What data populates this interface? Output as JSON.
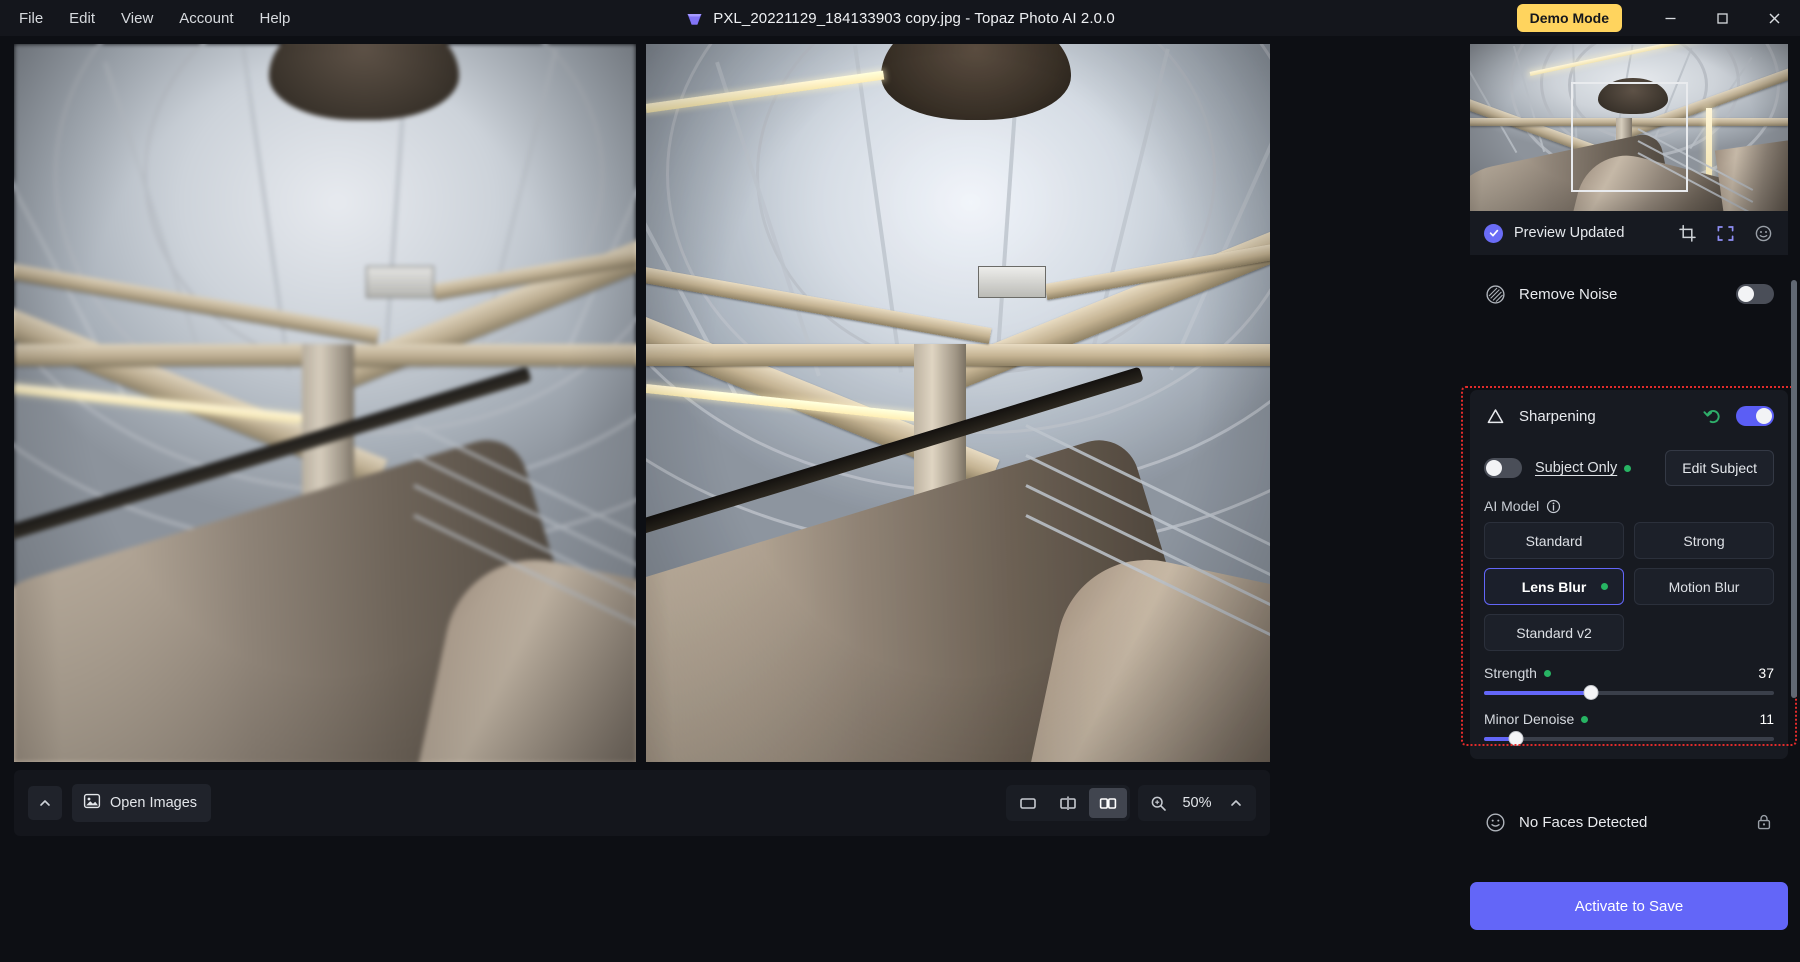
{
  "app": {
    "title": "PXL_20221129_184133903 copy.jpg - Topaz Photo AI 2.0.0",
    "logo_icon": "topaz-gem-icon",
    "accent_color": "#6366f8",
    "demo_badge": "Demo Mode",
    "demo_badge_color": "#ffd45e"
  },
  "menubar": {
    "items": [
      {
        "label": "File"
      },
      {
        "label": "Edit"
      },
      {
        "label": "View"
      },
      {
        "label": "Account"
      },
      {
        "label": "Help"
      }
    ]
  },
  "window_controls": {
    "minimize_icon": "minimize-icon",
    "maximize_icon": "maximize-icon",
    "close_icon": "close-icon"
  },
  "navigator": {
    "viewport_rect_present": true,
    "preview_status": "Preview Updated",
    "status_icon": "check-circle-icon",
    "actions": [
      {
        "name": "crop-icon",
        "label": "Crop"
      },
      {
        "name": "fullscreen-icon",
        "label": "Fit to screen"
      },
      {
        "name": "face-icon",
        "label": "Faces"
      }
    ]
  },
  "panels": {
    "remove_noise": {
      "icon": "noise-icon",
      "title": "Remove Noise",
      "enabled": false
    },
    "sharpening": {
      "icon": "sharpen-triangle-icon",
      "title": "Sharpening",
      "enabled": true,
      "reset_icon": "undo-arrow-icon",
      "highlighted": true,
      "subject_only": {
        "label": "Subject Only",
        "enabled": false,
        "has_change_dot": true
      },
      "edit_subject_label": "Edit Subject",
      "ai_model": {
        "label": "AI Model",
        "info_icon": "info-icon",
        "options": [
          {
            "label": "Standard",
            "selected": false,
            "has_dot": false
          },
          {
            "label": "Strong",
            "selected": false,
            "has_dot": false
          },
          {
            "label": "Lens Blur",
            "selected": true,
            "has_dot": true
          },
          {
            "label": "Motion Blur",
            "selected": false,
            "has_dot": false
          },
          {
            "label": "Standard v2",
            "selected": false,
            "has_dot": false
          }
        ]
      },
      "sliders": [
        {
          "label": "Strength",
          "value": 37,
          "max": 100,
          "has_dot": true
        },
        {
          "label": "Minor Denoise",
          "value": 11,
          "max": 100,
          "has_dot": true
        }
      ]
    },
    "faces": {
      "icon": "smiley-icon",
      "title": "No Faces Detected",
      "lock_icon": "lock-icon"
    }
  },
  "save": {
    "label": "Activate to Save"
  },
  "bottombar": {
    "collapse_icon": "chevron-up-icon",
    "open_images": {
      "icon": "image-icon",
      "label": "Open Images"
    },
    "view_modes": [
      {
        "name": "single-view-icon",
        "selected": false
      },
      {
        "name": "split-view-icon",
        "selected": false
      },
      {
        "name": "side-by-side-view-icon",
        "selected": true
      }
    ],
    "zoom": {
      "icon": "magnifier-icon",
      "value": "50%",
      "caret_icon": "chevron-up-icon"
    }
  }
}
